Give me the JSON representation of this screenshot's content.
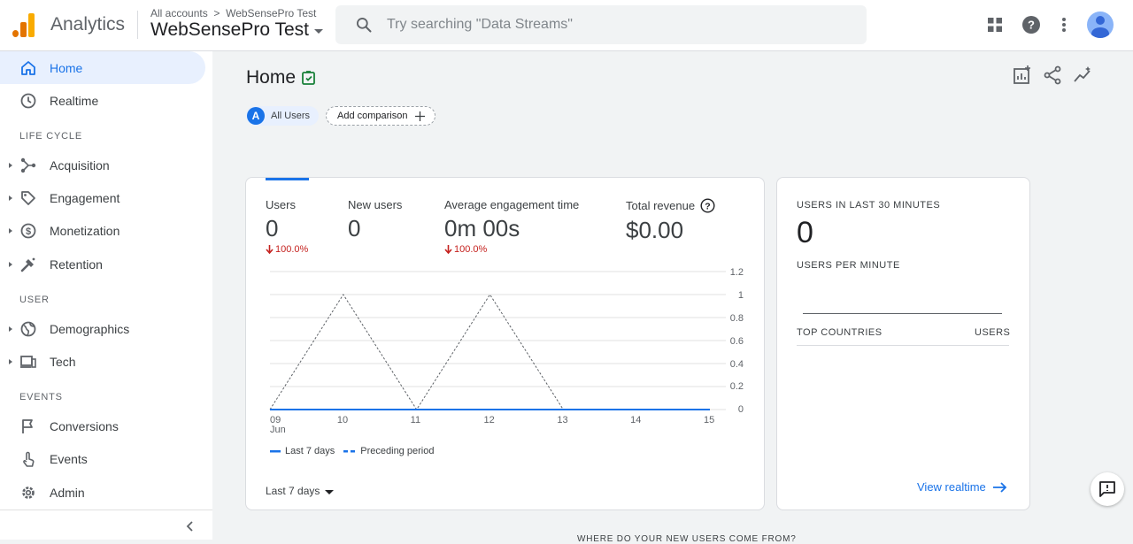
{
  "header": {
    "app_name": "Analytics",
    "crumb_root": "All accounts",
    "crumb_property": "WebSensePro Test",
    "property_name": "WebSensePro Test",
    "search_placeholder": "Try searching \"Data Streams\"",
    "icons": [
      "apps-grid-icon",
      "help-icon",
      "more-vert-icon",
      "account-avatar"
    ]
  },
  "sidebar": {
    "items": [
      {
        "label": "Home",
        "icon": "home-icon",
        "active": true
      },
      {
        "label": "Realtime",
        "icon": "clock-icon"
      }
    ],
    "sections": [
      {
        "title": "LIFE CYCLE",
        "items": [
          {
            "label": "Acquisition",
            "icon": "acquisition-icon"
          },
          {
            "label": "Engagement",
            "icon": "tag-icon"
          },
          {
            "label": "Monetization",
            "icon": "dollar-icon"
          },
          {
            "label": "Retention",
            "icon": "retention-icon"
          }
        ]
      },
      {
        "title": "USER",
        "items": [
          {
            "label": "Demographics",
            "icon": "globe-icon"
          },
          {
            "label": "Tech",
            "icon": "devices-icon"
          }
        ]
      },
      {
        "title": "EVENTS",
        "items": [
          {
            "label": "Conversions",
            "icon": "flag-icon"
          },
          {
            "label": "Events",
            "icon": "touch-icon"
          }
        ]
      }
    ],
    "admin": {
      "label": "Admin",
      "icon": "gear-icon"
    }
  },
  "main": {
    "title": "Home",
    "chips": {
      "all_users_letter": "A",
      "all_users": "All Users",
      "add_comparison": "Add comparison"
    },
    "metrics": [
      {
        "label": "Users",
        "value": "0",
        "delta": "100.0%"
      },
      {
        "label": "New users",
        "value": "0",
        "delta": ""
      },
      {
        "label": "Average engagement time",
        "value": "0m 00s",
        "delta": "100.0%"
      },
      {
        "label": "Total revenue",
        "value": "$0.00",
        "delta": ""
      }
    ],
    "legend": {
      "current": "Last 7 days",
      "previous": "Preceding period"
    },
    "date_range": "Last 7 days",
    "colors": {
      "current": "#1a73e8",
      "previous": "#5f6368",
      "decline": "#c5221f"
    }
  },
  "chart_data": {
    "type": "line",
    "categories": [
      "09 Jun",
      "10",
      "11",
      "12",
      "13",
      "14",
      "15"
    ],
    "x_tick_labels": [
      "09",
      "10",
      "11",
      "12",
      "13",
      "14",
      "15"
    ],
    "x_month_label": "Jun",
    "series": [
      {
        "name": "Last 7 days",
        "values": [
          0,
          0,
          0,
          0,
          0,
          0,
          0
        ]
      },
      {
        "name": "Preceding period",
        "values": [
          0,
          1,
          0,
          1,
          0,
          0,
          0
        ]
      }
    ],
    "y_ticks": [
      "0",
      "0.2",
      "0.4",
      "0.6",
      "0.8",
      "1",
      "1.2"
    ],
    "ylim": [
      0,
      1.2
    ],
    "grid": true
  },
  "realtime": {
    "title": "USERS IN LAST 30 MINUTES",
    "value": "0",
    "per_minute": "USERS PER MINUTE",
    "col_countries": "TOP COUNTRIES",
    "col_users": "USERS",
    "link": "View realtime"
  },
  "footer": {
    "section_title": "WHERE DO YOUR NEW USERS COME FROM?"
  }
}
